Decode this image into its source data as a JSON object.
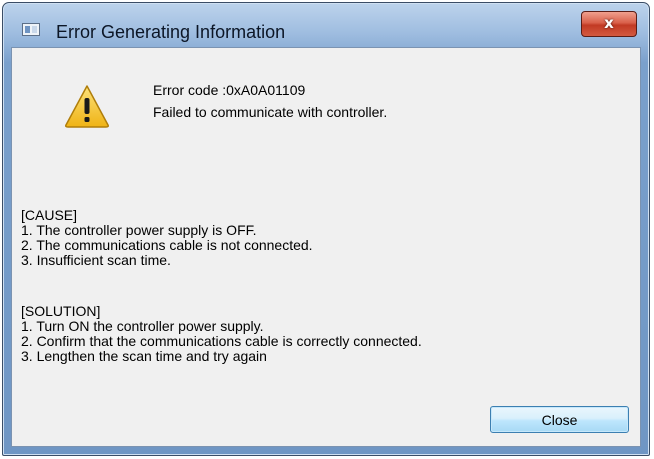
{
  "window": {
    "title": "Error Generating Information",
    "close_glyph": "x"
  },
  "message": {
    "icon": "warning-icon",
    "error_code": "Error code :0xA0A01109",
    "text": "Failed to communicate with controller."
  },
  "cause": {
    "heading": "[CAUSE]",
    "items": [
      "1. The controller power supply is OFF.",
      "2. The communications cable is not connected.",
      "3. Insufficient scan time."
    ]
  },
  "solution": {
    "heading": "[SOLUTION]",
    "items": [
      "1. Turn ON the controller power supply.",
      "2. Confirm that the communications cable is correctly connected.",
      "3. Lengthen the scan time and try again"
    ]
  },
  "buttons": {
    "close_label": "Close"
  },
  "colors": {
    "warning_fill": "#f5c52a",
    "title_bar": "#9fbde0",
    "close_red": "#c23a24"
  }
}
